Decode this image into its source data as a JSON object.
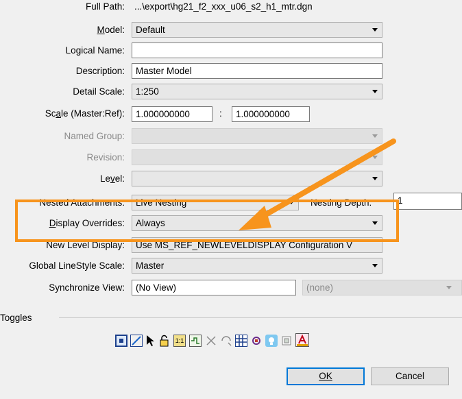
{
  "form": {
    "full_path_label": "Full Path:",
    "full_path_value": "...\\export\\hg21_f2_xxx_u06_s2_h1_mtr.dgn",
    "model_label": "Model:",
    "model_value": "Default",
    "logical_name_label": "Logical Name:",
    "logical_name_value": "",
    "description_label": "Description:",
    "description_value": "Master Model",
    "detail_scale_label": "Detail Scale:",
    "detail_scale_value": "1:250",
    "scale_label": "Scale (Master:Ref):",
    "scale_master": "1.000000000",
    "scale_colon": ":",
    "scale_ref": "1.000000000",
    "named_group_label": "Named Group:",
    "named_group_value": "",
    "revision_label": "Revision:",
    "revision_value": "",
    "level_label": "Level:",
    "level_value": "",
    "nested_label": "Nested Attachments:",
    "nested_value": "Live Nesting",
    "nesting_depth_label": "Nesting Depth:",
    "nesting_depth_value": "1",
    "display_overrides_label": "Display Overrides:",
    "display_overrides_value": "Always",
    "new_level_label": "New Level Display:",
    "new_level_value": "Use MS_REF_NEWLEVELDISPLAY Configuration V",
    "linestyle_label": "Global LineStyle Scale:",
    "linestyle_value": "Master",
    "sync_view_label": "Synchronize View:",
    "sync_view_value": "(No View)",
    "sync_view_option": "(none)"
  },
  "toggles": {
    "section_label": "Toggles"
  },
  "buttons": {
    "ok": "OK",
    "cancel": "Cancel"
  },
  "annotation": {
    "color": "#f7941d"
  }
}
